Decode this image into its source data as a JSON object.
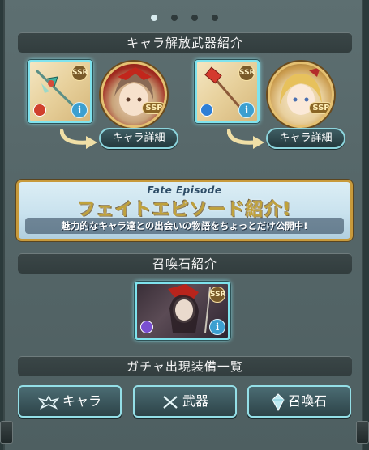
{
  "pagination": {
    "total": 4,
    "active_index": 0
  },
  "sections": {
    "weapons_title": "キャラ解放武器紹介",
    "summon_title": "召喚石紹介",
    "gacha_title": "ガチャ出現装備一覧"
  },
  "weapons": [
    {
      "rarity": "SSR",
      "element_color": "#d0402d",
      "detail_label": "キャラ詳細",
      "char_rarity": "SSR",
      "char_element_color": "#d0402d"
    },
    {
      "rarity": "SSR",
      "element_color": "#2e7fd6",
      "detail_label": "キャラ詳細",
      "char_rarity": "SSR",
      "char_element_color": "#2e7fd6"
    }
  ],
  "banner": {
    "subtitle": "Fate Episode",
    "title": "フェイトエピソード紹介!",
    "description": "魅力的なキャラ達との出会いの物語をちょっとだけ公開中!"
  },
  "summon": {
    "rarity": "SSR",
    "element_color": "#7a4fd1"
  },
  "info_glyph": "i",
  "tabs": [
    {
      "label": "キャラ",
      "icon": "character-emblem-icon"
    },
    {
      "label": "武器",
      "icon": "crossed-swords-icon"
    },
    {
      "label": "召喚石",
      "icon": "crystal-icon"
    }
  ],
  "colors": {
    "accent_cyan": "#7fe3ee",
    "gold": "#c89a3b",
    "panel": "#566769"
  }
}
